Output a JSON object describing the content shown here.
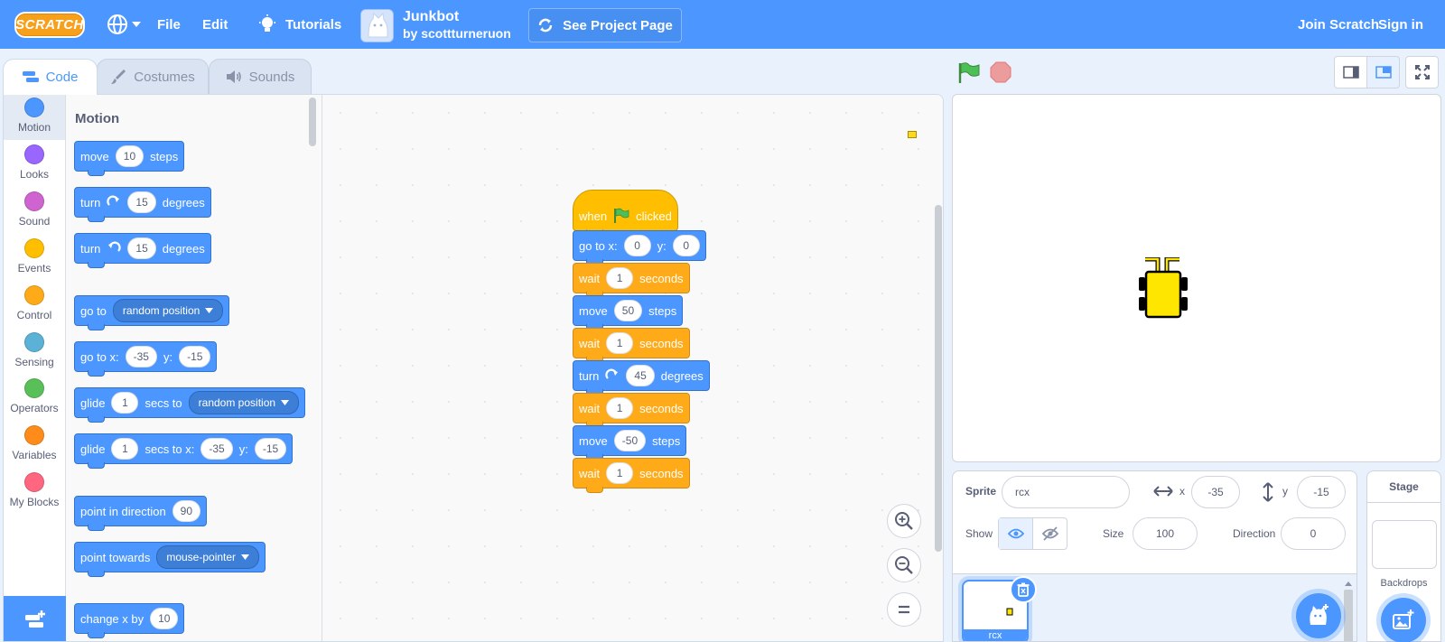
{
  "menubar": {
    "logo": "SCRATCH",
    "file": "File",
    "edit": "Edit",
    "tutorials": "Tutorials",
    "project_title": "Junkbot",
    "project_author": "by scottturneruon",
    "see_project_page": "See Project Page",
    "join": "Join Scratch",
    "sign_in": "Sign in"
  },
  "tabs": {
    "code": "Code",
    "costumes": "Costumes",
    "sounds": "Sounds"
  },
  "categories": [
    {
      "label": "Motion",
      "color": "#4c97ff"
    },
    {
      "label": "Looks",
      "color": "#9966ff"
    },
    {
      "label": "Sound",
      "color": "#cf63cf"
    },
    {
      "label": "Events",
      "color": "#ffbf00"
    },
    {
      "label": "Control",
      "color": "#ffab19"
    },
    {
      "label": "Sensing",
      "color": "#5cb1d6"
    },
    {
      "label": "Operators",
      "color": "#59c059"
    },
    {
      "label": "Variables",
      "color": "#ff8c1a"
    },
    {
      "label": "My Blocks",
      "color": "#ff6680"
    }
  ],
  "palette": {
    "title": "Motion",
    "move": {
      "a": "move",
      "v": "10",
      "b": "steps"
    },
    "turn_right": {
      "a": "turn",
      "v": "15",
      "b": "degrees"
    },
    "turn_left": {
      "a": "turn",
      "v": "15",
      "b": "degrees"
    },
    "go_to": {
      "a": "go to",
      "d": "random position"
    },
    "go_to_xy": {
      "a": "go to x:",
      "x": "-35",
      "b": "y:",
      "y": "-15"
    },
    "glide_to": {
      "a": "glide",
      "v": "1",
      "b": "secs to",
      "d": "random position"
    },
    "glide_xy": {
      "a": "glide",
      "v": "1",
      "b": "secs to x:",
      "x": "-35",
      "c": "y:",
      "y": "-15"
    },
    "point_dir": {
      "a": "point in direction",
      "v": "90"
    },
    "point_towards": {
      "a": "point towards",
      "d": "mouse-pointer"
    },
    "change_x": {
      "a": "change x by",
      "v": "10"
    }
  },
  "script": {
    "hat": {
      "a": "when",
      "b": "clicked"
    },
    "goto": {
      "a": "go to x:",
      "x": "0",
      "b": "y:",
      "y": "0"
    },
    "wait1": {
      "a": "wait",
      "v": "1",
      "b": "seconds"
    },
    "move1": {
      "a": "move",
      "v": "50",
      "b": "steps"
    },
    "wait2": {
      "a": "wait",
      "v": "1",
      "b": "seconds"
    },
    "turn": {
      "a": "turn",
      "v": "45",
      "b": "degrees"
    },
    "wait3": {
      "a": "wait",
      "v": "1",
      "b": "seconds"
    },
    "move2": {
      "a": "move",
      "v": "-50",
      "b": "steps"
    },
    "wait4": {
      "a": "wait",
      "v": "1",
      "b": "seconds"
    }
  },
  "sprite_info": {
    "sprite_label": "Sprite",
    "sprite_name": "rcx",
    "x_label": "x",
    "x_value": "-35",
    "y_label": "y",
    "y_value": "-15",
    "show_label": "Show",
    "size_label": "Size",
    "size_value": "100",
    "direction_label": "Direction",
    "direction_value": "0",
    "sprite_tile_name": "rcx"
  },
  "stage_pane": {
    "title": "Stage",
    "backdrops": "Backdrops"
  }
}
